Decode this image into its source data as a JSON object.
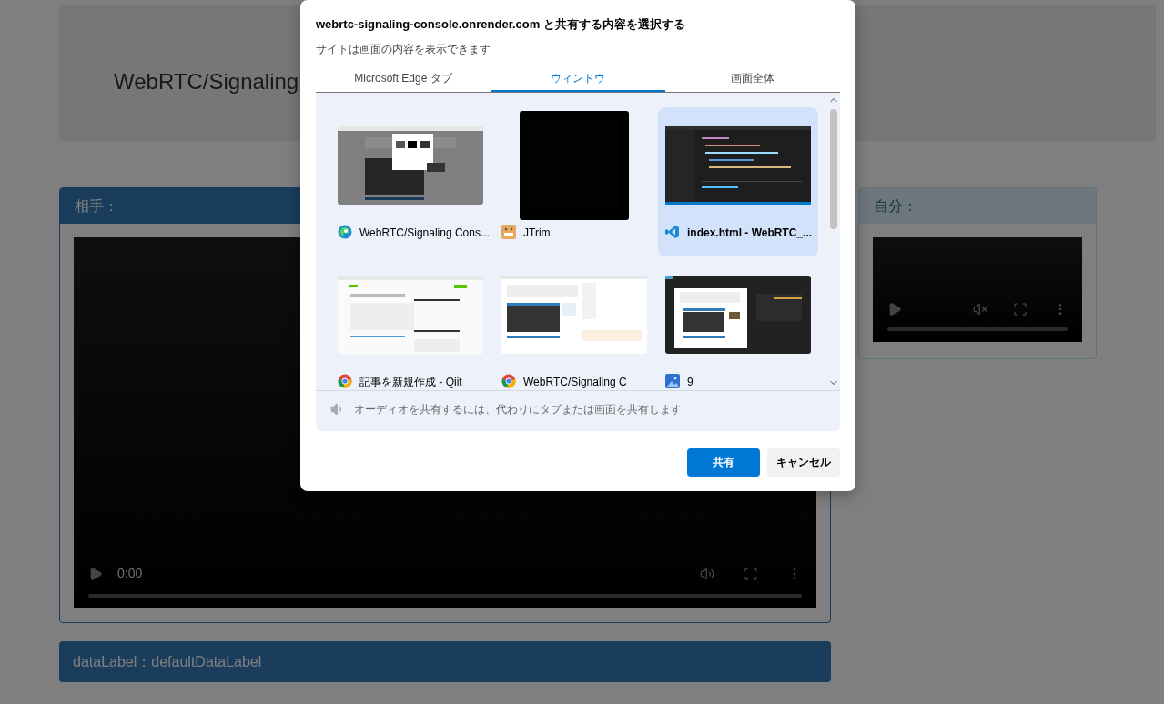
{
  "page": {
    "title": "WebRTC/Signaling",
    "peer_panel": {
      "title": "相手：",
      "video": {
        "time": "0:00",
        "muted": false
      }
    },
    "self_panel": {
      "title": "自分：",
      "video": {
        "muted": true
      }
    },
    "data_label": "dataLabel：defaultDataLabel"
  },
  "dialog": {
    "title": "webrtc-signaling-console.onrender.com と共有する内容を選択する",
    "subtitle": "サイトは画面の内容を表示できます",
    "tabs": [
      {
        "label": "Microsoft Edge タブ",
        "selected": false
      },
      {
        "label": "ウィンドウ",
        "selected": true
      },
      {
        "label": "画面全体",
        "selected": false
      }
    ],
    "windows": [
      {
        "label": "WebRTC/Signaling Cons...",
        "selected": false
      },
      {
        "label": "JTrim",
        "selected": false
      },
      {
        "label": "index.html - WebRTC_...",
        "selected": true
      },
      {
        "label": "記事を新規作成 - Qiit",
        "selected": false
      },
      {
        "label": "WebRTC/Signaling C",
        "selected": false
      },
      {
        "label": "9",
        "selected": false
      }
    ],
    "audio_note": "オーディオを共有するには、代わりにタブまたは画面を共有します",
    "buttons": [
      {
        "label": "共有",
        "kind": "primary"
      },
      {
        "label": "キャンセル",
        "kind": "secondary"
      }
    ]
  }
}
